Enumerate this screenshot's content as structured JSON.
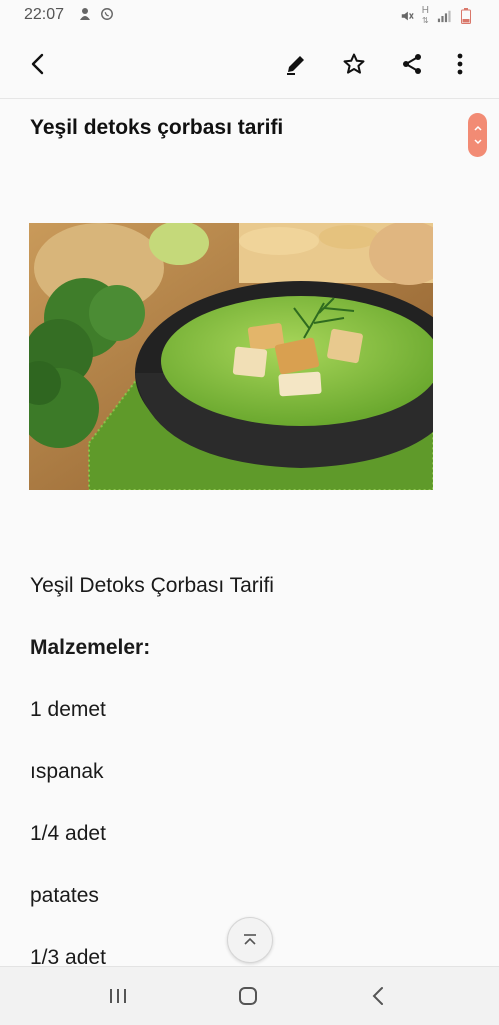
{
  "status_bar": {
    "time": "22:07",
    "left_icons": [
      "notification-icon",
      "whatsapp-icon"
    ],
    "right_icons": [
      "mute-icon",
      "data-icon",
      "signal-icon",
      "battery-icon"
    ],
    "data_indicator": "H"
  },
  "app_bar": {
    "icons": [
      "back-icon",
      "edit-icon",
      "star-icon",
      "share-icon",
      "more-icon"
    ]
  },
  "note": {
    "title": "Yeşil detoks çorbası tarifi",
    "image_alt": "green detox soup with croutons and broccoli",
    "lines": [
      {
        "text": "Yeşil Detoks Çorbası Tarifi",
        "bold": false
      },
      {
        "text": "Malzemeler:",
        "bold": true
      },
      {
        "text": "1 demet",
        "bold": false
      },
      {
        "text": "ıspanak",
        "bold": false
      },
      {
        "text": "1/4 adet",
        "bold": false
      },
      {
        "text": "patates",
        "bold": false
      },
      {
        "text": "1/3 adet",
        "bold": false
      }
    ]
  },
  "colors": {
    "scroll_handle": "#f28b74",
    "soup_green": "#7fc041",
    "bowl": "#2a2a2a"
  },
  "nav_bar": {
    "icons": [
      "recents-icon",
      "home-icon",
      "nav-back-icon"
    ]
  }
}
